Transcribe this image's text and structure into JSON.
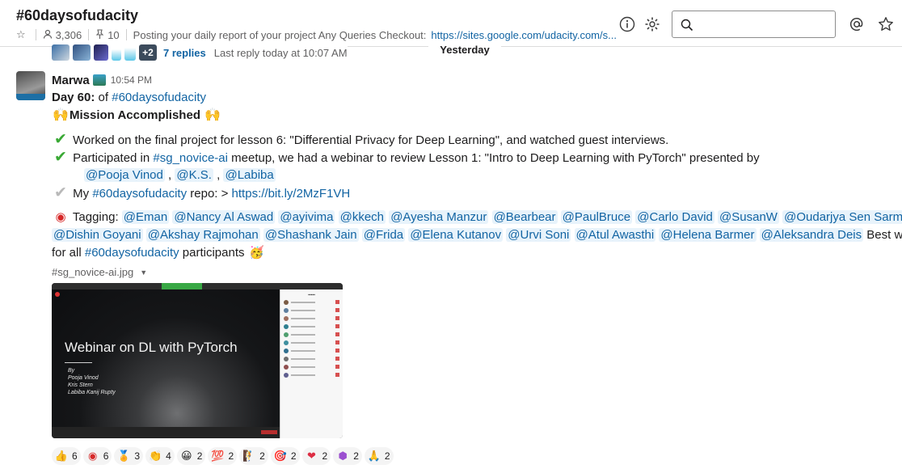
{
  "channel": {
    "name": "#60daysofudacity",
    "member_count": "3,306",
    "pinned_count": "10",
    "topic": "Posting your daily report of your project Any Queries Checkout:",
    "topic_link": "https://sites.google.com/udacity.com/s..."
  },
  "thread_summary": {
    "extra_count": "+2",
    "replies_label": "7 replies",
    "last_reply": "Last reply today at 10:07 AM"
  },
  "day_divider": "Yesterday",
  "message": {
    "author": "Marwa",
    "time": "10:54 PM",
    "day_label": "Day 60:",
    "day_of": " of ",
    "day_channel": "#60daysofudacity",
    "accomplished": "Mission Accomplished",
    "item1": "Worked on the final project for lesson 6: \"Differential Privacy for Deep Learning\", and watched guest interviews.",
    "item2_pre": "Participated in ",
    "item2_channel": "#sg_novice-ai",
    "item2_post": " meetup, we had a webinar to review Lesson 1: \"Intro to Deep Learning with PyTorch\" presented by",
    "presenters": [
      "@Pooja Vinod",
      "@K.S.",
      "@Labiba"
    ],
    "item3_pre": "My ",
    "item3_channel": "#60daysofudacity",
    "item3_mid": " repo: > ",
    "item3_link": "https://bit.ly/2MzF1VH",
    "tagging_label": "Tagging: ",
    "tags_line1": [
      "@Eman",
      "@Nancy Al Aswad",
      "@ayivima",
      "@kkech",
      "@Ayesha Manzur",
      "@Bearbear",
      "@PaulBruce",
      "@Carlo David",
      "@SusanW",
      "@Oudarjya Sen Sarma"
    ],
    "tags_line2": [
      "@Dishin Goyani",
      "@Akshay Rajmohan",
      "@Shashank Jain",
      "@Frida",
      "@Elena Kutanov",
      "@Urvi Soni",
      "@Atul Awasthi",
      "@Helena Barmer",
      "@Aleksandra Deis"
    ],
    "best_wishes": " Best wishes",
    "for_all": "for all ",
    "closing_channel": "#60daysofudacity",
    "participants": " participants"
  },
  "attachment": {
    "file_name": "#sg_novice-ai.jpg",
    "image_title": "Webinar on DL with PyTorch",
    "image_by": [
      "By",
      "Pooja Vinod",
      "Kris Stern",
      "Labiba Kanij Rupty"
    ]
  },
  "reactions": [
    {
      "icon": "thumbs-up",
      "glyph": "👍",
      "count": "6"
    },
    {
      "icon": "udacity-logo",
      "glyph": "◉",
      "count": "6"
    },
    {
      "icon": "medal",
      "glyph": "🏅",
      "count": "3"
    },
    {
      "icon": "clapping-hands",
      "glyph": "👏",
      "count": "4"
    },
    {
      "icon": "grinning-face",
      "glyph": "😀",
      "count": "2"
    },
    {
      "icon": "hundred-points",
      "glyph": "💯",
      "count": "2"
    },
    {
      "icon": "person-climbing",
      "glyph": "🧗",
      "count": "2"
    },
    {
      "icon": "target",
      "glyph": "🎯",
      "count": "2"
    },
    {
      "icon": "red-heart",
      "glyph": "❤",
      "count": "2"
    },
    {
      "icon": "hexagon-badge",
      "glyph": "⬢",
      "count": "2"
    },
    {
      "icon": "thank-you",
      "glyph": "🙏",
      "count": "2"
    }
  ],
  "colors": {
    "link": "#1264a3",
    "mention_bg": "#e8f3fb",
    "text": "#1d1c1d",
    "muted": "#616061",
    "check_green": "#3aa935"
  }
}
